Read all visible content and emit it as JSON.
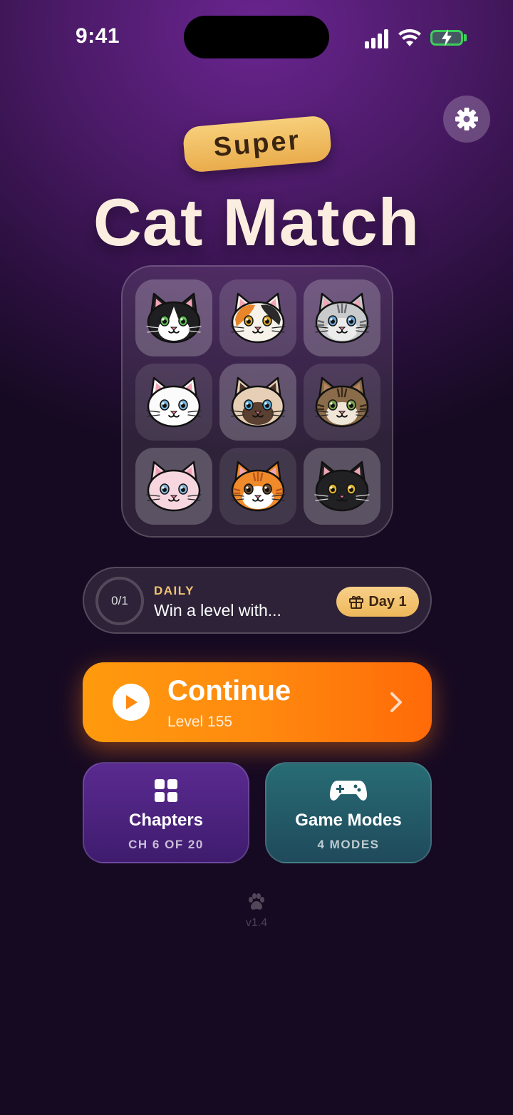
{
  "status_bar": {
    "time": "9:41"
  },
  "header": {
    "settings_icon": "gear-icon",
    "badge": "Super",
    "title": "Cat Match"
  },
  "cat_grid": {
    "tiles": [
      {
        "breed": "tuxedo",
        "fur": "#1f1f22",
        "face": "#ffffff",
        "ear": "#f2a5b5",
        "eye": "#5fbf55",
        "stripes": false
      },
      {
        "breed": "calico",
        "fur": "#f7f2ea",
        "patch1": "#e8852a",
        "patch2": "#2a2a2a",
        "ear": "#f2a5b5",
        "eye": "#d9a62a"
      },
      {
        "breed": "silver-tabby",
        "fur": "#c9cacc",
        "face": "#ececec",
        "ear": "#f2a5b5",
        "eye": "#6fa7d6",
        "stripes": true
      },
      {
        "breed": "white",
        "fur": "#fbfbfb",
        "face": "#ffffff",
        "ear": "#f2a5b5",
        "eye": "#7bb4de"
      },
      {
        "breed": "siamese",
        "fur": "#e6cfb4",
        "face": "#5a4030",
        "ear": "#4a3328",
        "eye": "#5aa8d8"
      },
      {
        "breed": "maine-coon",
        "fur": "#8a6c4a",
        "face": "#efe6d8",
        "ear": "#b48560",
        "eye": "#7aa34a",
        "stripes": true
      },
      {
        "breed": "sphynx",
        "fur": "#f7d6df",
        "face": "#f7d6df",
        "ear": "#f0a3b8",
        "eye": "#86b8d8"
      },
      {
        "breed": "orange-tabby",
        "fur": "#f08a2a",
        "face": "#ffffff",
        "ear": "#f2a5b5",
        "eye": "#6b4a2a",
        "stripes": true
      },
      {
        "breed": "black",
        "fur": "#212124",
        "face": "#212124",
        "ear": "#f2a5b5",
        "eye": "#e0b52a"
      }
    ]
  },
  "daily": {
    "progress": "0/1",
    "label": "DAILY",
    "description": "Win a level with...",
    "day_label": "Day 1",
    "day_icon": "gift-icon"
  },
  "continue": {
    "title": "Continue",
    "subtitle": "Level 155",
    "icon": "play-icon"
  },
  "chapters": {
    "title": "Chapters",
    "subtitle": "CH 6 OF 20",
    "icon": "grid-icon"
  },
  "game_modes": {
    "title": "Game Modes",
    "subtitle": "4 MODES",
    "icon": "gamepad-icon"
  },
  "footer": {
    "version": "v1.4",
    "icon": "paw-icon"
  },
  "colors": {
    "accent_orange": "#ff8a0f",
    "gold": "#f1c471",
    "chapters_purple": "#4d2380",
    "modes_teal": "#255c68"
  }
}
